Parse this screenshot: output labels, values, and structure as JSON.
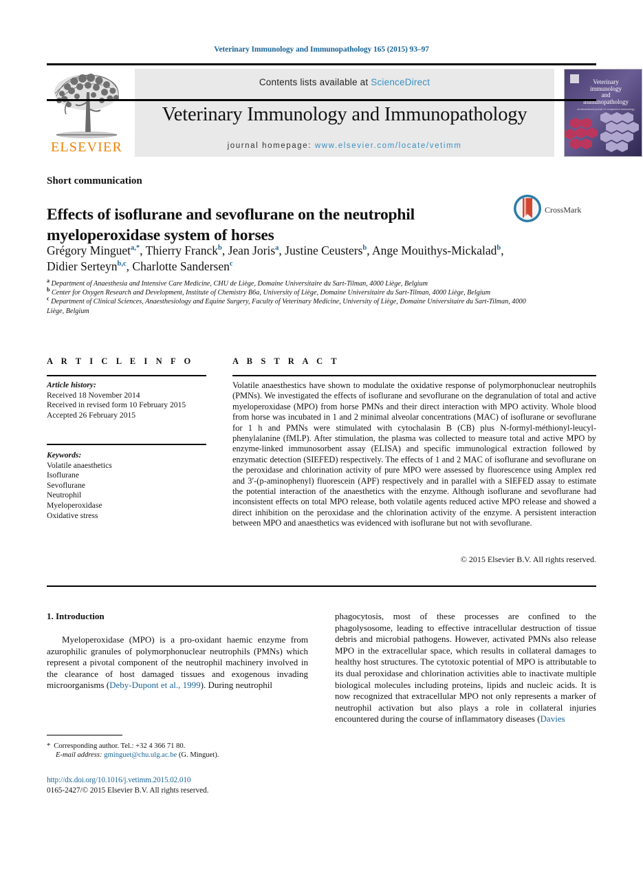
{
  "header": {
    "running_head": "Veterinary Immunology and Immunopathology 165 (2015) 93–97",
    "contents_prefix": "Contents lists available at ",
    "contents_link": "ScienceDirect",
    "journal_name": "Veterinary Immunology and Immunopathology",
    "homepage_prefix": "journal homepage: ",
    "homepage_url": "www.elsevier.com/locate/vetimm",
    "publisher": "ELSEVIER",
    "cover_title_line1": "Veterinary",
    "cover_title_line2": "immunology",
    "cover_title_line3": "and",
    "cover_title_line4": "immunopathology",
    "cover_subtitle": "an international journal of comparative immunology"
  },
  "article": {
    "kind": "Short communication",
    "title": "Effects of isoflurane and sevoflurane on the neutrophil myeloperoxidase system of horses",
    "crossmark_label": "CrossMark",
    "authors": [
      {
        "name": "Grégory Minguet",
        "marks": "a,*",
        "sep": ", "
      },
      {
        "name": "Thierry Franck",
        "marks": "b",
        "sep": ", "
      },
      {
        "name": "Jean Joris",
        "marks": "a",
        "sep": ", "
      },
      {
        "name": "Justine Ceusters",
        "marks": "b",
        "sep": ", "
      },
      {
        "name": "Ange Mouithys-Mickalad",
        "marks": "b",
        "sep": ", "
      },
      {
        "name": "Didier Serteyn",
        "marks": "b,c",
        "sep": ", "
      },
      {
        "name": "Charlotte Sandersen",
        "marks": "c",
        "sep": ""
      }
    ],
    "affiliations": [
      {
        "marker": "a",
        "text": "Department of Anaesthesia and Intensive Care Medicine, CHU de Liège, Domaine Universitaire du Sart-Tilman, 4000 Liège, Belgium"
      },
      {
        "marker": "b",
        "text": "Center for Oxygen Research and Development, Institute of Chemistry B6a, University of Liège, Domaine Universitaire du Sart-Tilman, 4000 Liège, Belgium"
      },
      {
        "marker": "c",
        "text": "Department of Clinical Sciences, Anaesthesiology and Equine Surgery, Faculty of Veterinary Medicine, University of Liège, Domaine Universitaire du Sart-Tilman, 4000 Liège, Belgium"
      }
    ]
  },
  "info": {
    "heading": "A R T I C L E   I N F O",
    "history_label": "Article history:",
    "history": [
      "Received 18 November 2014",
      "Received in revised form 10 February 2015",
      "Accepted 26 February 2015"
    ],
    "keywords_label": "Keywords:",
    "keywords": [
      "Volatile anaesthetics",
      "Isoflurane",
      "Sevoflurane",
      "Neutrophil",
      "Myeloperoxidase",
      "Oxidative stress"
    ]
  },
  "abstract": {
    "heading": "A B S T R A C T",
    "text": "Volatile anaesthestics have shown to modulate the oxidative response of polymorphonuclear neutrophils (PMNs). We investigated the effects of isoflurane and sevoflurane on the degranulation of total and active myeloperoxidase (MPO) from horse PMNs and their direct interaction with MPO activity. Whole blood from horse was incubated in 1 and 2 minimal alveolar concentrations (MAC) of isoflurane or sevoflurane for 1 h and PMNs were stimulated with cytochalasin B (CB) plus N-formyl-méthionyl-leucyl-phenylalanine (fMLP). After stimulation, the plasma was collected to measure total and active MPO by enzyme-linked immunosorbent assay (ELISA) and specific immunological extraction followed by enzymatic detection (SIEFED) respectively. The effects of 1 and 2 MAC of isoflurane and sevoflurane on the peroxidase and chlorination activity of pure MPO were assessed by fluorescence using Amplex red and 3′-(p-aminophenyl) fluorescein (APF) respectively and in parallel with a SIEFED assay to estimate the potential interaction of the anaesthetics with the enzyme. Although isoflurane and sevoflurane had inconsistent effects on total MPO release, both volatile agents reduced active MPO release and showed a direct inhibition on the peroxidase and the chlorination activity of the enzyme. A persistent interaction between MPO and anaesthetics was evidenced with isoflurane but not with sevoflurane.",
    "copyright": "© 2015 Elsevier B.V. All rights reserved."
  },
  "body": {
    "section_number_title": "1.  Introduction",
    "left_paragraph_pre": "Myeloperoxidase (MPO) is a pro-oxidant haemic enzyme from azurophilic granules of polymorphonuclear neutrophils (PMNs) which represent a pivotal component of the neutrophil machinery involved in the clearance of host damaged tissues and exogenous invading microorganisms (",
    "left_paragraph_ref": "Deby-Dupont et al., 1999",
    "left_paragraph_post": "). During neutrophil",
    "right_paragraph_pre": "phagocytosis, most of these processes are confined to the phagolysosome, leading to effective intracellular destruction of tissue debris and microbial pathogens. However, activated PMNs also release MPO in the extracellular space, which results in collateral damages to healthy host structures. The cytotoxic potential of MPO is attributable to its dual peroxidase and chlorination activities able to inactivate multiple biological molecules including proteins, lipids and nucleic acids. It is now recognized that extracellular MPO not only represents a marker of neutrophil activation but also plays a role in collateral injuries encountered during the course of inflammatory diseases (",
    "right_paragraph_ref": "Davies"
  },
  "footer": {
    "corresponding_marker": "*",
    "corresponding_text": "Corresponding author. Tel.: +32 4 366 71 80.",
    "email_label": "E-mail address:",
    "email": "gminguet@chu.ulg.ac.be",
    "email_suffix": "(G. Minguet).",
    "doi": "http://dx.doi.org/10.1016/j.vetimm.2015.02.010",
    "issn_line": "0165-2427/© 2015 Elsevier B.V. All rights reserved."
  },
  "colors": {
    "link": "#1a6496",
    "sciencedirect": "#3a8fc0",
    "elsevier_orange": "#f08000",
    "band_gray": "#e9e9e9",
    "crossmark_blue": "#2b7ca8",
    "crossmark_red": "#d1462f"
  }
}
